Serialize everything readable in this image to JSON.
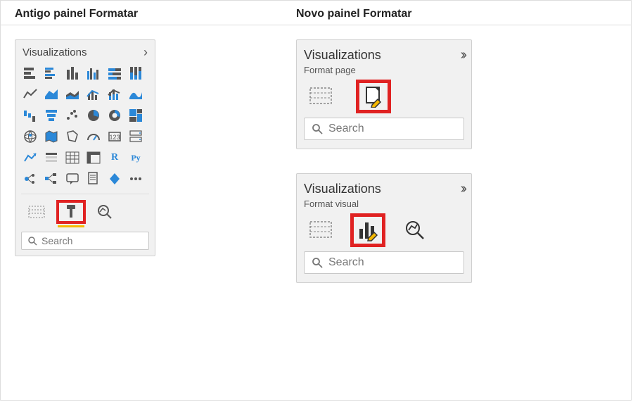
{
  "headings": {
    "left": "Antigo painel Formatar",
    "right": "Novo painel Formatar"
  },
  "old_panel": {
    "title": "Visualizations",
    "search_placeholder": "Search",
    "viz_icons": [
      "stacked-bar-chart",
      "clustered-bar-chart",
      "stacked-column-chart",
      "clustered-column-chart",
      "100-stacked-bar-chart",
      "100-stacked-column-chart",
      "line-chart",
      "area-chart",
      "stacked-area-chart",
      "line-clustered-column-chart",
      "line-stacked-column-chart",
      "ribbon-chart",
      "waterfall-chart",
      "funnel-chart",
      "scatter-chart",
      "pie-chart",
      "donut-chart",
      "treemap",
      "map",
      "filled-map",
      "shape-map",
      "gauge",
      "card",
      "multi-row-card",
      "kpi",
      "slicer",
      "table",
      "matrix",
      "r-visual",
      "python-visual",
      "key-influencers",
      "decomposition-tree",
      "qa-visual",
      "paginated-report",
      "powerapps",
      "custom-visual"
    ],
    "tabs": [
      "fields-tab",
      "format-tab",
      "analytics-tab"
    ],
    "selected_tab": "format-tab"
  },
  "new_panels": [
    {
      "title": "Visualizations",
      "subtitle": "Format page",
      "tabs": [
        "build-visual-tab",
        "format-page-tab"
      ],
      "selected_tab": "format-page-tab",
      "search_placeholder": "Search"
    },
    {
      "title": "Visualizations",
      "subtitle": "Format visual",
      "tabs": [
        "build-visual-tab",
        "format-visual-tab",
        "analytics-tab"
      ],
      "selected_tab": "format-visual-tab",
      "search_placeholder": "Search"
    }
  ],
  "py_label": "Py",
  "r_label": "R"
}
